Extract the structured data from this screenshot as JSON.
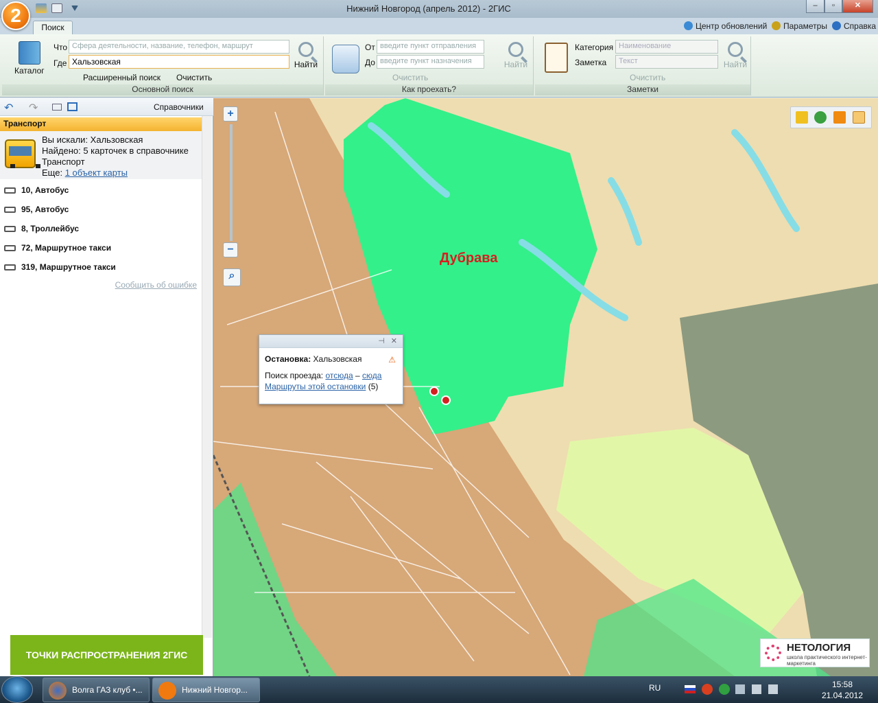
{
  "window": {
    "title": "Нижний Новгород (апрель 2012) - 2ГИС",
    "logo": "2"
  },
  "tabs": {
    "search": "Поиск"
  },
  "topbar": {
    "updates": "Центр обновлений",
    "params": "Параметры",
    "help": "Справка"
  },
  "main_search": {
    "catalog": "Каталог",
    "what_label": "Что",
    "what_placeholder": "Сфера деятельности, название, телефон, маршрут",
    "where_label": "Где",
    "where_value": "Хальзовская",
    "find": "Найти",
    "advanced": "Расширенный поиск",
    "clear": "Очистить",
    "caption": "Основной поиск"
  },
  "route_search": {
    "from_label": "От",
    "from_placeholder": "введите пункт отправления",
    "to_label": "До",
    "to_placeholder": "введите пункт назначения",
    "find": "Найти",
    "clear": "Очистить",
    "caption": "Как проехать?"
  },
  "notes": {
    "category_label": "Категория",
    "category_placeholder": "Наименование",
    "note_label": "Заметка",
    "note_placeholder": "Текст",
    "find": "Найти",
    "clear": "Очистить",
    "caption": "Заметки"
  },
  "left_panel": {
    "directories": "Справочники",
    "section": "Транспорт",
    "searched": "Вы искали: Хальзовская",
    "found": "Найдено: 5 карточек в справочнике",
    "category": "Транспорт",
    "more_label": "Еще:",
    "more_link": "1 объект карты",
    "report": "Сообщить об ошибке",
    "promo": "ТОЧКИ РАСПРОСТРАНЕНИЯ 2ГИС",
    "routes": [
      "10, Автобус",
      "95, Автобус",
      "8, Троллейбус",
      "72, Маршрутное такси",
      "319, Маршрутное такси"
    ]
  },
  "map": {
    "area_label": "Дубрава",
    "popup": {
      "stop_label": "Остановка:",
      "stop_name": "Хальзовская",
      "route_label": "Поиск проезда:",
      "from": "отсюда",
      "dash": "–",
      "to": "сюда",
      "routes_link": "Маршруты этой остановки",
      "routes_count": "(5)"
    },
    "watermark": {
      "name": "НЕТОЛОГИЯ",
      "tagline": "школа практического интернет-маркетинга"
    }
  },
  "taskbar": {
    "items": [
      "Волга ГАЗ клуб •...",
      "Нижний Новгор..."
    ],
    "lang": "RU",
    "time": "15:58",
    "date": "21.04.2012"
  },
  "colors": {
    "forest": "#33f08a",
    "river": "#86dde6",
    "residential": "#d7a878",
    "industrial": "#8c9a80",
    "field": "#eeddb0",
    "meadow": "#e2f6a8",
    "buildings": "#2eb87a",
    "ribbon": "#e6efe4",
    "promo": "#7bb51a",
    "accent_orange": "#f4b330"
  },
  "icons": [
    "logo-icon",
    "catalog-icon",
    "search-icon",
    "route-icon",
    "notes-icon",
    "bus-icon",
    "zoom-in-icon",
    "zoom-out-icon",
    "update-icon",
    "gear-icon",
    "help-icon"
  ]
}
